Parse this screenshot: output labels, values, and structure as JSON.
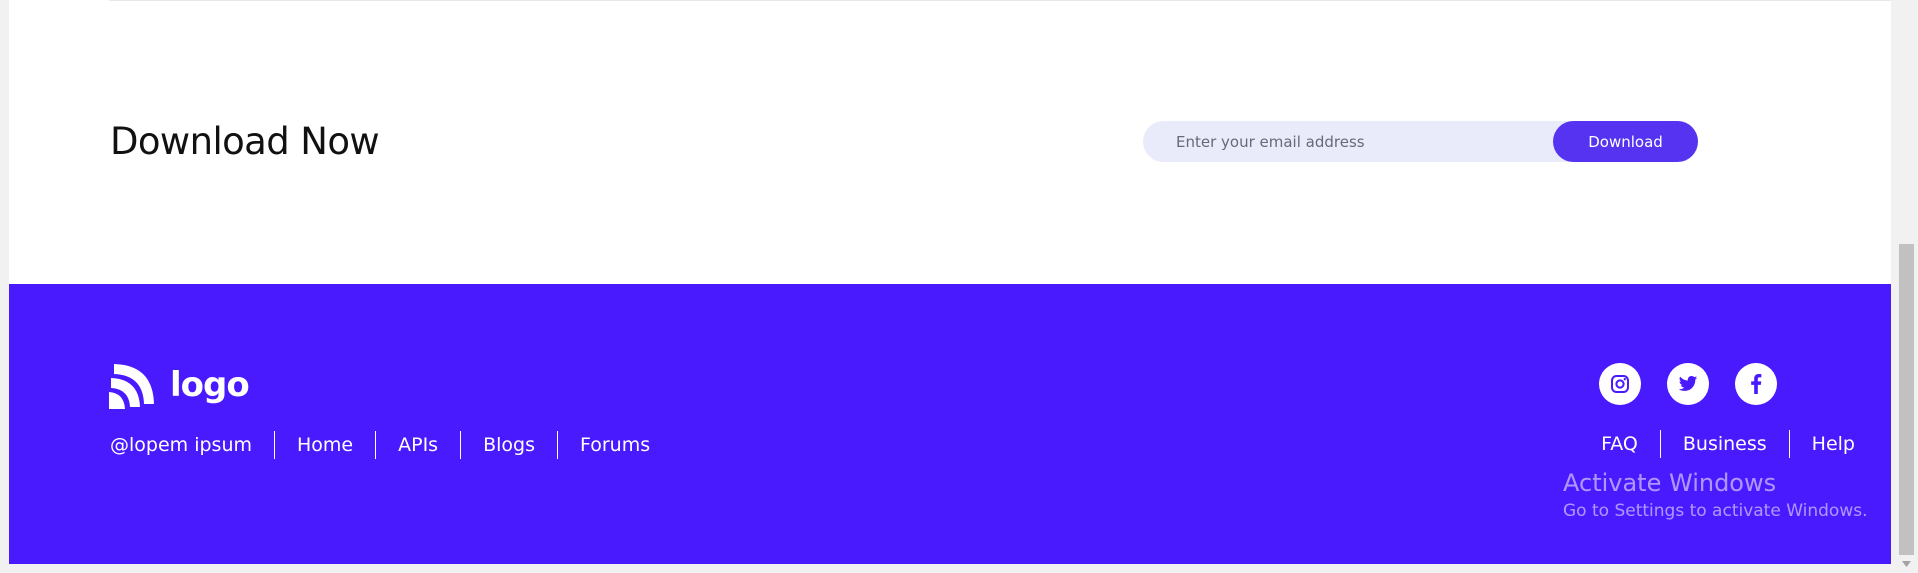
{
  "download": {
    "title": "Download Now",
    "email_placeholder": "Enter your email address",
    "email_value": "",
    "button_label": "Download"
  },
  "footer": {
    "logo_text": "logo",
    "links": [
      "@lopem ipsum",
      "Home",
      "APIs",
      "Blogs",
      "Forums"
    ],
    "social": [
      {
        "name": "instagram-icon",
        "label": "Instagram"
      },
      {
        "name": "twitter-icon",
        "label": "Twitter"
      },
      {
        "name": "facebook-icon",
        "label": "Facebook"
      }
    ],
    "right_links": [
      "FAQ",
      "Business",
      "Help"
    ],
    "colors": {
      "background": "#4a1aff",
      "accent_button": "#5533f0",
      "input_bg": "#e9ebfb"
    }
  },
  "watermark": {
    "title": "Activate Windows",
    "subtitle": "Go to Settings to activate Windows."
  }
}
